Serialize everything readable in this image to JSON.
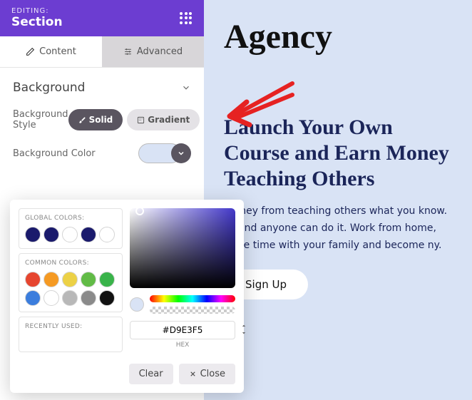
{
  "header": {
    "editing_label": "EDITING:",
    "section_label": "Section"
  },
  "tabs": {
    "content": "Content",
    "advanced": "Advanced"
  },
  "panel": {
    "background_title": "Background",
    "bg_style_label": "Background Style",
    "bg_color_label": "Background Color",
    "solid": "Solid",
    "gradient": "Gradient"
  },
  "picker": {
    "global_label": "GLOBAL COLORS:",
    "common_label": "COMMON COLORS:",
    "recent_label": "RECENTLY USED:",
    "global_colors": [
      "#1a1a6c",
      "#1a1a6c",
      "#ffffff",
      "#1a1a6c",
      "#ffffff"
    ],
    "common_colors": [
      "#e6452f",
      "#f59a23",
      "#ecd146",
      "#61bb46",
      "#39b34a",
      "#3b7ddd",
      "#ffffff",
      "#b8b8b8",
      "#8a8a8a",
      "#111111"
    ],
    "hex_value": "#D9E3F5",
    "hex_label": "HEX",
    "clear": "Clear",
    "close": "Close",
    "current": "#d9e3f5"
  },
  "preview": {
    "logo": "Agency",
    "heading": "Launch Your Own Course and Earn Money Teaching Others",
    "body": "money from teaching others what you know. sy and anyone can do it. Work from home, more time with your family and become ny.",
    "signup": "Sign Up"
  }
}
